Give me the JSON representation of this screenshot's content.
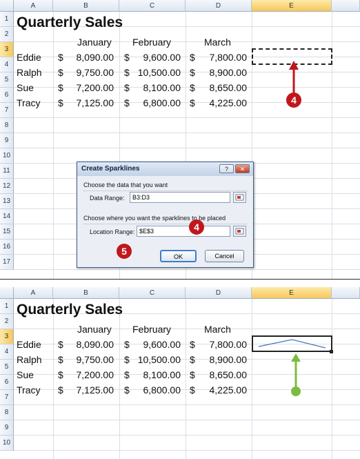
{
  "columns": [
    "A",
    "B",
    "C",
    "D",
    "E"
  ],
  "title": "Quarterly Sales",
  "months": [
    "January",
    "February",
    "March"
  ],
  "currency": "$",
  "rows": [
    {
      "name": "Eddie",
      "jan": "8,090.00",
      "feb": "9,600.00",
      "mar": "7,800.00"
    },
    {
      "name": "Ralph",
      "jan": "9,750.00",
      "feb": "10,500.00",
      "mar": "8,900.00"
    },
    {
      "name": "Sue",
      "jan": "7,200.00",
      "feb": "8,100.00",
      "mar": "8,650.00"
    },
    {
      "name": "Tracy",
      "jan": "7,125.00",
      "feb": "6,800.00",
      "mar": "4,225.00"
    }
  ],
  "top_row_numbers": [
    "1",
    "2",
    "3",
    "4",
    "5",
    "6",
    "7",
    "8",
    "9",
    "10",
    "11",
    "12",
    "13",
    "14",
    "15",
    "16",
    "17"
  ],
  "bottom_row_numbers": [
    "1",
    "2",
    "3",
    "4",
    "5",
    "6",
    "7",
    "8",
    "9",
    "10"
  ],
  "dialog": {
    "title": "Create Sparklines",
    "help_label": "?",
    "close_label": "✕",
    "section1": "Choose the data that you want",
    "data_range_label": "Data Range:",
    "data_range_value": "B3:D3",
    "section2": "Choose where you want the sparklines to be placed",
    "location_range_label": "Location Range:",
    "location_range_value": "$E$3",
    "ok_label": "OK",
    "cancel_label": "Cancel"
  },
  "callouts": {
    "step4": "4",
    "step5": "5"
  },
  "sparkline": {
    "values": [
      8090,
      9600,
      7800
    ],
    "color": "#4a78b8"
  },
  "colors": {
    "callout_red": "#c0171d",
    "callout_green": "#7dbb3f",
    "selected_header": "#f7c75a"
  },
  "icons": {
    "range_picker": "range-picker-icon",
    "help": "help-icon",
    "close": "close-icon"
  }
}
